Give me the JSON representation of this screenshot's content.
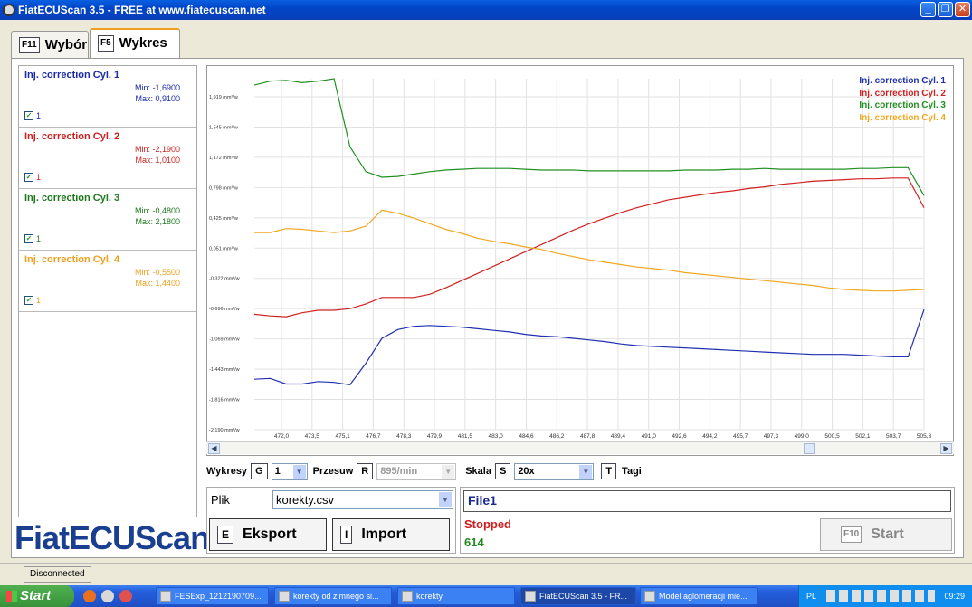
{
  "window": {
    "title": "FiatECUScan 3.5 - FREE at www.fiatecuscan.net"
  },
  "tabs": [
    {
      "key": "F11",
      "label": "Wybór"
    },
    {
      "key": "F5",
      "label": "Wykres"
    }
  ],
  "channels": [
    {
      "title": "Inj. correction Cyl. 1",
      "min": "Min: -1,6900",
      "max": "Max: 0,9100",
      "check": "1",
      "color": "#1a2aa8"
    },
    {
      "title": "Inj. correction Cyl. 2",
      "min": "Min: -2,1900",
      "max": "Max: 1,0100",
      "check": "1",
      "color": "#cc2020"
    },
    {
      "title": "Inj. correction Cyl. 3",
      "min": "Min: -0,4800",
      "max": "Max: 2,1800",
      "check": "1",
      "color": "#1e8a1e"
    },
    {
      "title": "Inj. correction Cyl. 4",
      "min": "Min: -0,5500",
      "max": "Max: 1,4400",
      "check": "1",
      "color": "#f0a820"
    }
  ],
  "logo": "FiatECUScan",
  "chart_data": {
    "type": "line",
    "x": [
      "471,0",
      "472,0",
      "473,5",
      "474,4",
      "475,1",
      "475,9",
      "476,7",
      "477,5",
      "478,3",
      "479,1",
      "479,9",
      "480,7",
      "481,5",
      "482,3",
      "483,0",
      "483,8",
      "484,6",
      "485,4",
      "486,2",
      "487,0",
      "487,8",
      "488,6",
      "489,4",
      "490,2",
      "491,0",
      "491,8",
      "492,6",
      "493,4",
      "494,2",
      "494,9",
      "495,7",
      "496,5",
      "497,3",
      "498,1",
      "499,0",
      "499,8",
      "500,5",
      "501,3",
      "502,1",
      "502,9",
      "503,7",
      "504,5",
      "505,3"
    ],
    "x_tick_labels": [
      "472,0",
      "473,5",
      "475,1",
      "476,7",
      "478,3",
      "479,9",
      "481,5",
      "483,0",
      "484,6",
      "486,2",
      "487,8",
      "489,4",
      "491,0",
      "492,6",
      "494,2",
      "495,7",
      "497,3",
      "499,0",
      "500,5",
      "502,1",
      "503,7",
      "505,3"
    ],
    "y_tick_labels": [
      "1,919 mm³/w",
      "1,545 mm³/w",
      "1,172 mm³/w",
      "0,798 mm³/w",
      "0,425 mm³/w",
      "0,051 mm³/w",
      "-0,322 mm³/w",
      "-0,696 mm³/w",
      "-1,069 mm³/w",
      "-1,443 mm³/w",
      "-1,816 mm³/w",
      "-2,190 mm³/w"
    ],
    "ylim": [
      -2.19,
      2.19
    ],
    "grid": true,
    "legend_position": "top-right",
    "series": [
      {
        "name": "Inj. correction Cyl. 1",
        "color": "#2030b0",
        "values": [
          -1.56,
          -1.55,
          -1.62,
          -1.62,
          -1.59,
          -1.6,
          -1.63,
          -1.36,
          -1.05,
          -0.94,
          -0.9,
          -0.89,
          -0.9,
          -0.91,
          -0.93,
          -0.95,
          -0.97,
          -1.0,
          -1.02,
          -1.03,
          -1.05,
          -1.07,
          -1.09,
          -1.12,
          -1.14,
          -1.15,
          -1.16,
          -1.17,
          -1.18,
          -1.19,
          -1.2,
          -1.21,
          -1.22,
          -1.23,
          -1.24,
          -1.25,
          -1.25,
          -1.25,
          -1.26,
          -1.27,
          -1.28,
          -1.28,
          -0.69
        ]
      },
      {
        "name": "Inj. correction Cyl. 2",
        "color": "#d02020",
        "values": [
          -0.75,
          -0.77,
          -0.78,
          -0.73,
          -0.7,
          -0.7,
          -0.68,
          -0.62,
          -0.54,
          -0.54,
          -0.54,
          -0.5,
          -0.42,
          -0.33,
          -0.24,
          -0.15,
          -0.06,
          0.03,
          0.12,
          0.21,
          0.3,
          0.38,
          0.45,
          0.52,
          0.58,
          0.63,
          0.68,
          0.71,
          0.74,
          0.77,
          0.79,
          0.82,
          0.84,
          0.87,
          0.89,
          0.91,
          0.92,
          0.93,
          0.94,
          0.94,
          0.95,
          0.95,
          0.58
        ]
      },
      {
        "name": "Inj. correction Cyl. 3",
        "color": "#209020",
        "values": [
          2.11,
          2.16,
          2.17,
          2.14,
          2.16,
          2.19,
          1.34,
          1.03,
          0.96,
          0.97,
          1.0,
          1.03,
          1.05,
          1.06,
          1.07,
          1.07,
          1.07,
          1.06,
          1.05,
          1.05,
          1.05,
          1.04,
          1.04,
          1.04,
          1.04,
          1.04,
          1.04,
          1.05,
          1.05,
          1.05,
          1.06,
          1.06,
          1.07,
          1.06,
          1.06,
          1.06,
          1.06,
          1.06,
          1.07,
          1.07,
          1.08,
          1.08,
          0.73
        ]
      },
      {
        "name": "Inj. correction Cyl. 4",
        "color": "#f0a820",
        "values": [
          0.27,
          0.27,
          0.32,
          0.31,
          0.29,
          0.27,
          0.29,
          0.35,
          0.55,
          0.51,
          0.45,
          0.38,
          0.31,
          0.26,
          0.2,
          0.16,
          0.13,
          0.09,
          0.06,
          0.01,
          -0.03,
          -0.07,
          -0.1,
          -0.13,
          -0.16,
          -0.18,
          -0.2,
          -0.23,
          -0.25,
          -0.27,
          -0.29,
          -0.31,
          -0.33,
          -0.35,
          -0.37,
          -0.39,
          -0.42,
          -0.44,
          -0.45,
          -0.46,
          -0.46,
          -0.45,
          -0.44
        ]
      }
    ]
  },
  "controls": {
    "wykresy_label": "Wykresy",
    "wykresy_key": "G",
    "wykresy_value": "1",
    "przesuw_label": "Przesuw",
    "przesuw_key": "R",
    "przesuw_value": "895/min",
    "skala_label": "Skala",
    "skala_key": "S",
    "skala_value": "20x",
    "tagi_key": "T",
    "tagi_label": "Tagi"
  },
  "plik": {
    "label": "Plik",
    "value": "korekty.csv"
  },
  "buttons": {
    "eksport_key": "E",
    "eksport_label": "Eksport",
    "import_key": "I",
    "import_label": "Import",
    "start_key": "F10",
    "start_label": "Start"
  },
  "fileinfo": {
    "name": "File1",
    "status": "Stopped",
    "count": "614"
  },
  "statusbar": {
    "connection": "Disconnected"
  },
  "taskbar": {
    "start_label": "Start",
    "items": [
      {
        "label": "FESExp_1212190709..."
      },
      {
        "label": "korekty od zimnego si..."
      },
      {
        "label": "korekty"
      },
      {
        "label": "FiatECUScan 3.5 - FR..."
      },
      {
        "label": "Model aglomeracji mie..."
      }
    ],
    "lang": "PL",
    "clock": "09:29"
  }
}
